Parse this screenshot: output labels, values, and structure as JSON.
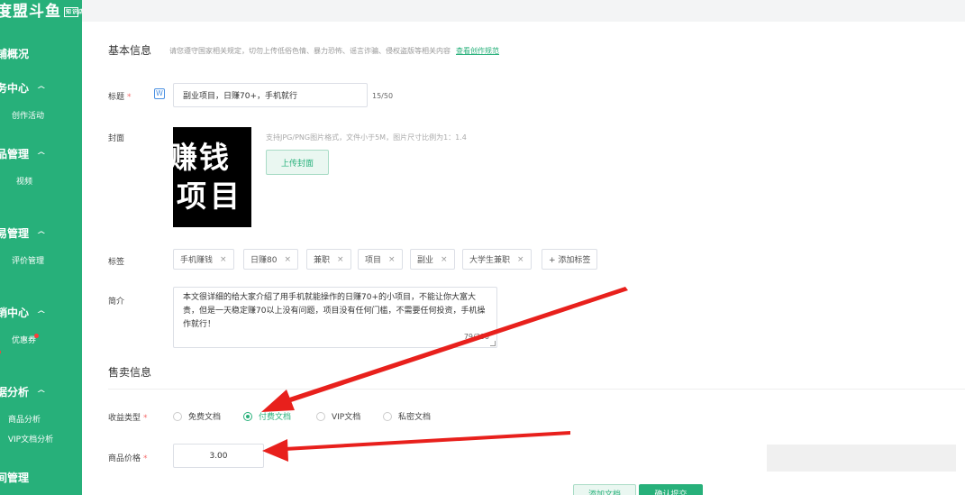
{
  "sidebar": {
    "brand": "度盟斗鱼",
    "brand_badge": "知识店铺",
    "overview": "铺概况",
    "groups": [
      {
        "label": "务中心",
        "chevron": "^"
      },
      {
        "label": "品管理",
        "chevron": "^"
      },
      {
        "label": "易管理",
        "chevron": "^"
      },
      {
        "label": "销中心",
        "chevron": "^"
      },
      {
        "label": "据分析",
        "chevron": "^"
      },
      {
        "label": "间管理"
      }
    ],
    "items": {
      "activity": "创作活动",
      "video": "视频",
      "review": "评价管理",
      "coupon": "优惠券",
      "product_analysis": "商品分析",
      "vip_analysis": "VIP文档分析"
    }
  },
  "basic_info": {
    "title": "基本信息",
    "notice": "请您遵守国家相关规定，切勿上传低俗色情、暴力恐怖、谣言诈骗、侵权盗版等相关内容",
    "notice_link": "查看创作规范"
  },
  "form": {
    "title_label": "标题",
    "required_mark": "*",
    "title_icon": "W",
    "title_value": "副业项目，日赚70+，手机就行",
    "title_count": "15/50",
    "cover_label": "封面",
    "cover_text_line1": "赚钱",
    "cover_text_line2": "项目",
    "cover_hint": "支持JPG/PNG图片格式，文件小于5M，图片尺寸比例为1：1.4",
    "upload_button": "上传封面",
    "tags_label": "标签",
    "tags": [
      "手机赚钱",
      "日赚80",
      "兼职",
      "项目",
      "副业",
      "大学生兼职"
    ],
    "tag_remove_glyph": "×",
    "add_tag": "+ 添加标签",
    "intro_label": "简介",
    "intro_value": "本文很详细的给大家介绍了用手机就能操作的日赚70+的小项目，不能让你大富大贵，但是一天稳定赚70以上没有问题，项目没有任何门槛，不需要任何投资，手机操作就行！",
    "intro_count": "79/200"
  },
  "sale_info": {
    "title": "售卖信息",
    "income_label": "收益类型",
    "income_options": [
      {
        "label": "免费文档",
        "checked": false
      },
      {
        "label": "付费文档",
        "checked": true
      },
      {
        "label": "VIP文档",
        "checked": false
      },
      {
        "label": "私密文档",
        "checked": false
      }
    ],
    "price_label": "商品价格",
    "price_value": "3.00"
  },
  "bottom_buttons": {
    "secondary": "添加文档",
    "primary": "确认提交"
  },
  "colors": {
    "brand_green": "#27b07a",
    "arrow_red": "#e8201c"
  }
}
